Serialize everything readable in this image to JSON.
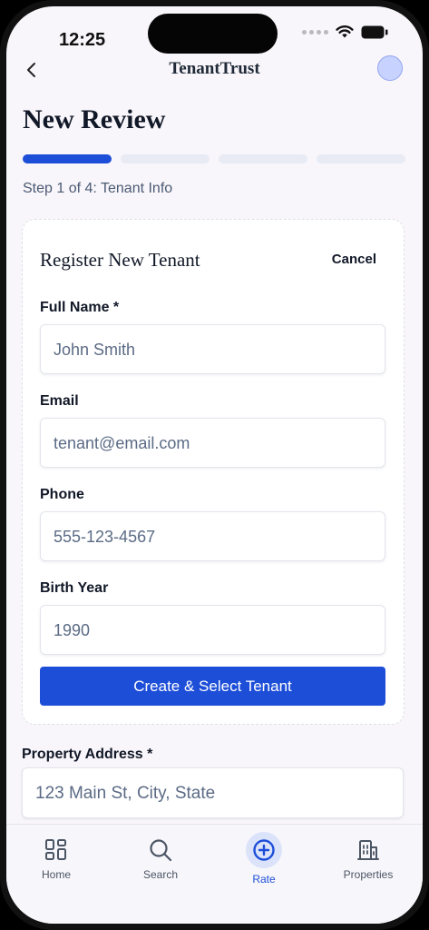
{
  "status_bar": {
    "time": "12:25"
  },
  "header": {
    "app_title": "TenantTrust"
  },
  "page": {
    "title": "New Review",
    "progress": {
      "current_step": 1,
      "total_steps": 4
    },
    "step_label": "Step 1 of 4: Tenant Info"
  },
  "register_card": {
    "title": "Register New Tenant",
    "cancel_label": "Cancel",
    "fields": [
      {
        "label": "Full Name *",
        "placeholder": "John Smith"
      },
      {
        "label": "Email",
        "placeholder": "tenant@email.com"
      },
      {
        "label": "Phone",
        "placeholder": "555-123-4567"
      },
      {
        "label": "Birth Year",
        "placeholder": "1990"
      }
    ],
    "submit_label": "Create & Select Tenant"
  },
  "property": {
    "label": "Property Address *",
    "placeholder": "123 Main St, City, State"
  },
  "tabbar": {
    "items": [
      {
        "label": "Home",
        "icon": "grid-icon"
      },
      {
        "label": "Search",
        "icon": "search-icon"
      },
      {
        "label": "Rate",
        "icon": "plus-circle-icon",
        "active": true
      },
      {
        "label": "Properties",
        "icon": "building-icon"
      }
    ]
  },
  "colors": {
    "accent": "#1d4ed8",
    "background": "#f8f6fa"
  }
}
